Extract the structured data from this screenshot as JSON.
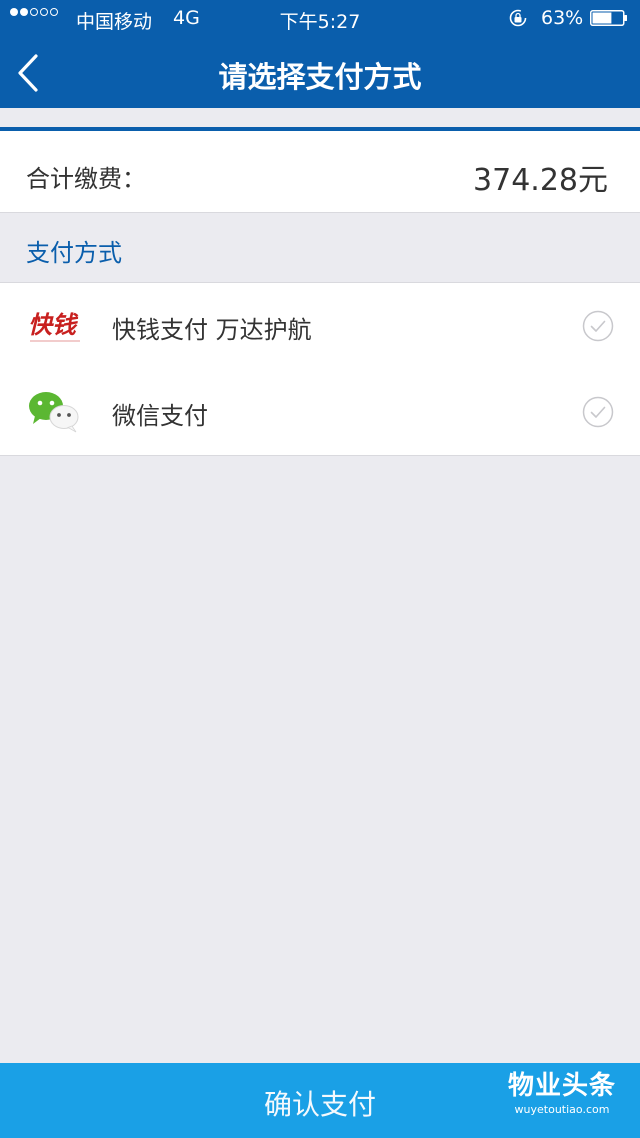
{
  "status_bar": {
    "carrier": "中国移动",
    "network": "4G",
    "time": "下午5:27",
    "battery_percent": "63%",
    "battery_level": 0.63,
    "signal_bars_filled": 2,
    "signal_bars_total": 5
  },
  "nav": {
    "title": "请选择支付方式",
    "back_icon": "chevron-left-icon"
  },
  "summary": {
    "label": "合计缴费：",
    "amount": "374.28元"
  },
  "section": {
    "title": "支付方式"
  },
  "payment_methods": [
    {
      "name": "快钱支付 万达护航",
      "logo": "kuaiqian-logo",
      "logo_text": "快钱",
      "selected": false
    },
    {
      "name": "微信支付",
      "logo": "wechat-logo",
      "selected": false
    }
  ],
  "footer": {
    "confirm_label": "确认支付",
    "watermark_title": "物业头条",
    "watermark_url": "wuyetoutiao.com"
  },
  "colors": {
    "nav_blue": "#0a5eac",
    "confirm_blue": "#1aa0e6",
    "background": "#ebebf0",
    "section_title": "#0a5eac",
    "kuaiqian_red": "#c8201f",
    "wechat_green": "#5bb732",
    "check_gray": "#c8c8cc"
  }
}
